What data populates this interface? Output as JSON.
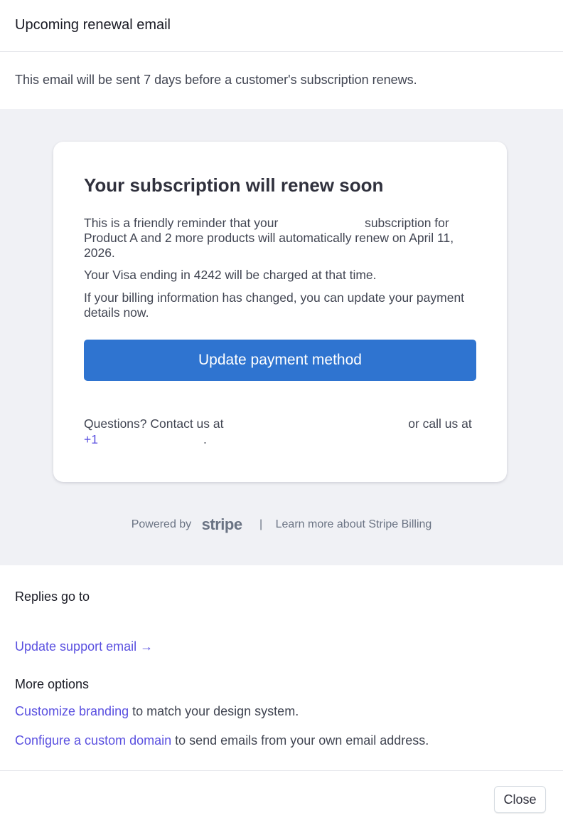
{
  "header": {
    "title": "Upcoming renewal email"
  },
  "description": "This email will be sent 7 days before a customer's subscription renews.",
  "email": {
    "title": "Your subscription will renew soon",
    "p1_start": "This is a friendly reminder that your",
    "p1_end": "subscription for Product A and 2 more products will automatically renew on April 11, 2026.",
    "p2": "Your Visa ending in 4242 will be charged at that time.",
    "p3": "If your billing information has changed, you can update your payment details now.",
    "cta_label": "Update payment method",
    "contact_start": "Questions? Contact us at",
    "contact_middle": "or call us at",
    "phone": "+1",
    "contact_end": "."
  },
  "powered": {
    "label": "Powered by",
    "logo": "stripe",
    "separator": "|",
    "learn_more": "Learn more about Stripe Billing"
  },
  "replies_label": "Replies go to",
  "support_link": "Update support email →",
  "more_options": {
    "title": "More options",
    "branding_link": "Customize branding",
    "branding_text": " to match your design system.",
    "domain_link": "Configure a custom domain",
    "domain_text": " to send emails from your own email address."
  },
  "footer": {
    "close_label": "Close"
  },
  "colors": {
    "accent": "#5a50e0",
    "button": "#2f74d0",
    "preview_bg": "#f0f1f5"
  }
}
